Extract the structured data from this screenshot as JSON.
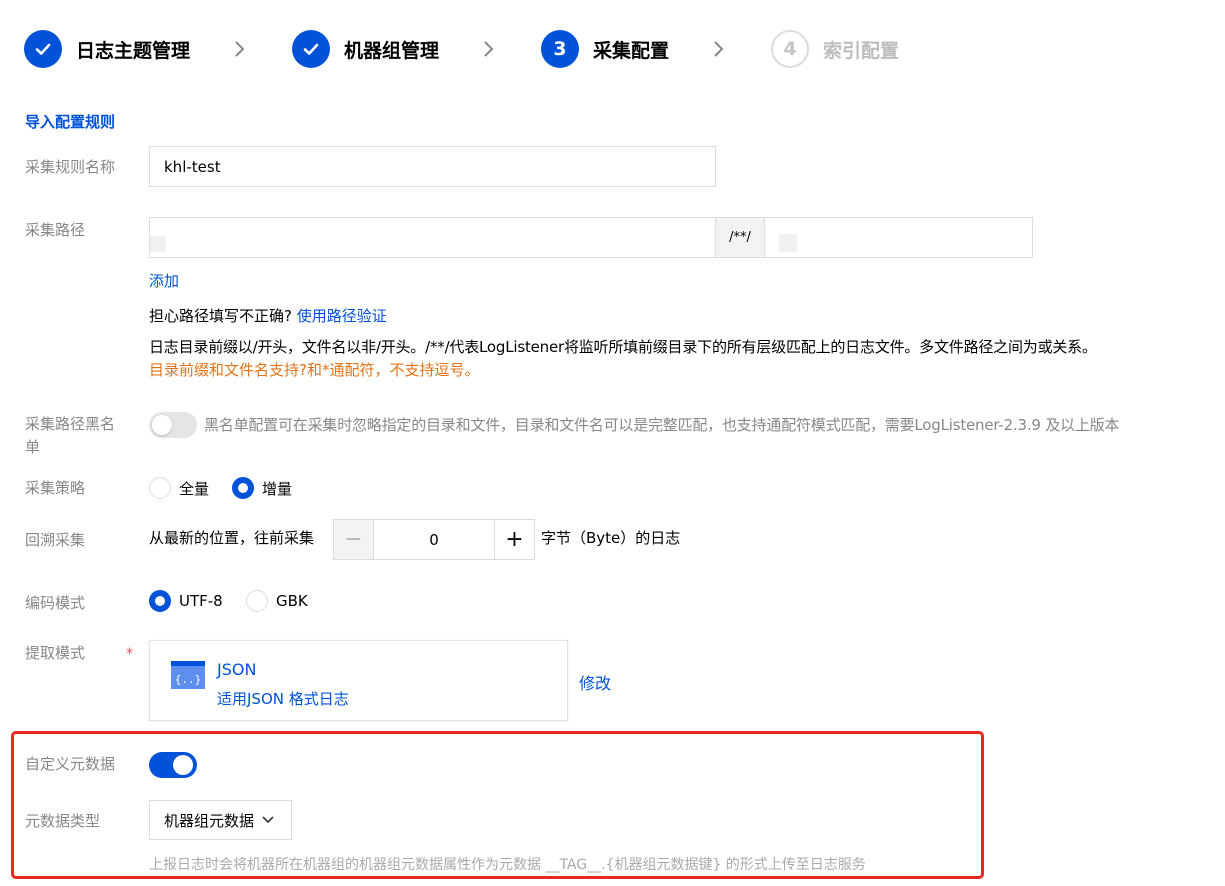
{
  "steps": [
    {
      "label": "日志主题管理",
      "state": "done",
      "num": ""
    },
    {
      "label": "机器组管理",
      "state": "done",
      "num": ""
    },
    {
      "label": "采集配置",
      "state": "active",
      "num": "3"
    },
    {
      "label": "索引配置",
      "state": "pending",
      "num": "4"
    }
  ],
  "import_rules": "导入配置规则",
  "rule_name": {
    "label": "采集规则名称",
    "value": "khl-test"
  },
  "path": {
    "label": "采集路径",
    "separator": "/**/",
    "add": "添加",
    "worry": "担心路径填写不正确?",
    "verify": "使用路径验证",
    "desc": "日志目录前缀以/开头，文件名以非/开头。/**/代表LogListener将监听所填前缀目录下的所有层级匹配上的日志文件。多文件路径之间为或关系。",
    "warn": "目录前缀和文件名支持?和*通配符，不支持逗号。"
  },
  "blacklist": {
    "label_line1": "采集路径黑名",
    "label_line2": "单",
    "desc": "黑名单配置可在采集时忽略指定的目录和文件，目录和文件名可以是完整匹配，也支持通配符模式匹配，需要LogListener-2.3.9 及以上版本"
  },
  "strategy": {
    "label": "采集策略",
    "options": [
      "全量",
      "增量"
    ],
    "selected": "增量"
  },
  "backtrack": {
    "label": "回溯采集",
    "prefix": "从最新的位置，往前采集",
    "value": "0",
    "suffix": "字节（Byte）的日志",
    "minus": "−",
    "plus": "+"
  },
  "encoding": {
    "label": "编码模式",
    "options": [
      "UTF-8",
      "GBK"
    ],
    "selected": "UTF-8"
  },
  "extract": {
    "label": "提取模式",
    "required": "*",
    "mode": "JSON",
    "mode_desc": "适用JSON 格式日志",
    "modify": "修改"
  },
  "metadata": {
    "label": "自定义元数据",
    "enabled": true,
    "type_label": "元数据类型",
    "type_value": "机器组元数据",
    "hint": "上报日志时会将机器所在机器组的机器组元数据属性作为元数据 __TAG__.{机器组元数据键} 的形式上传至日志服务"
  },
  "colors": {
    "primary": "#0052d9",
    "warning": "#e37318",
    "highlight": "#e8291f"
  }
}
